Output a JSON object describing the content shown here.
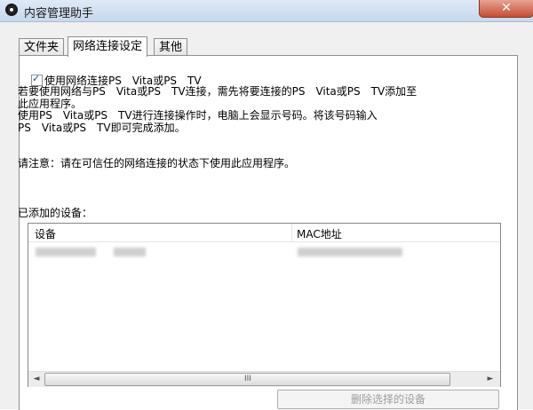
{
  "window": {
    "title": "内容管理助手",
    "close_glyph": "✕"
  },
  "tabs": [
    {
      "label": "文件夹",
      "active": false
    },
    {
      "label": "网络连接设定",
      "active": true
    },
    {
      "label": "其他",
      "active": false
    }
  ],
  "checkbox": {
    "label": "使用网络连接PS　Vita或PS　TV",
    "checked": true
  },
  "description_lines": [
    "若要使用网络与PS　Vita或PS　TV连接，需先将要连接的PS　Vita或PS　TV添加至",
    "此应用程序。",
    "使用PS　Vita或PS　TV进行连接操作时，电脑上会显示号码。将该号码输入",
    "PS　Vita或PS　TV即可完成添加。"
  ],
  "note": "请注意：请在可信任的网络连接的状态下使用此应用程序。",
  "devices": {
    "label": "已添加的设备：",
    "columns": [
      "设备",
      "MAC地址"
    ]
  },
  "scrollbar": {
    "left_glyph": "◄",
    "right_glyph": "►",
    "grip_glyph": "III"
  },
  "delete_button": "删除选择的设备"
}
